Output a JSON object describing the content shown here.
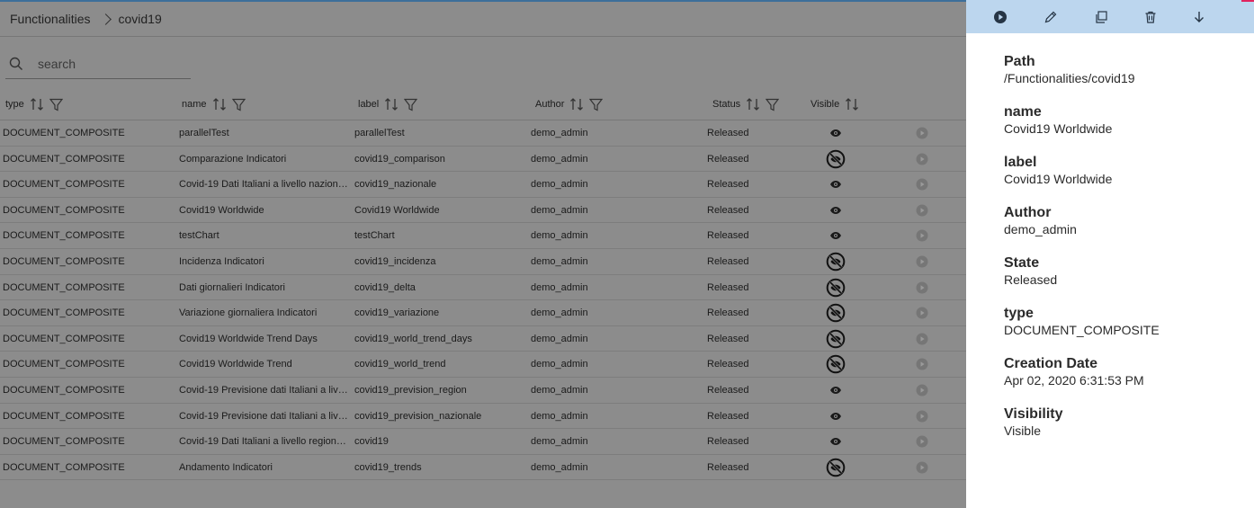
{
  "breadcrumb": {
    "root": "Functionalities",
    "current": "covid19"
  },
  "search": {
    "placeholder": "search"
  },
  "columns": {
    "type": "type",
    "name": "name",
    "label": "label",
    "author": "Author",
    "status": "Status",
    "visible": "Visible"
  },
  "rows": [
    {
      "type": "DOCUMENT_COMPOSITE",
      "name": "parallelTest",
      "label": "parallelTest",
      "author": "demo_admin",
      "status": "Released",
      "visible": true
    },
    {
      "type": "DOCUMENT_COMPOSITE",
      "name": "Comparazione Indicatori",
      "label": "covid19_comparison",
      "author": "demo_admin",
      "status": "Released",
      "visible": false
    },
    {
      "type": "DOCUMENT_COMPOSITE",
      "name": "Covid-19 Dati Italiani a livello nazion…",
      "label": "covid19_nazionale",
      "author": "demo_admin",
      "status": "Released",
      "visible": true
    },
    {
      "type": "DOCUMENT_COMPOSITE",
      "name": "Covid19 Worldwide",
      "label": "Covid19 Worldwide",
      "author": "demo_admin",
      "status": "Released",
      "visible": true
    },
    {
      "type": "DOCUMENT_COMPOSITE",
      "name": "testChart",
      "label": "testChart",
      "author": "demo_admin",
      "status": "Released",
      "visible": true
    },
    {
      "type": "DOCUMENT_COMPOSITE",
      "name": "Incidenza Indicatori",
      "label": "covid19_incidenza",
      "author": "demo_admin",
      "status": "Released",
      "visible": false
    },
    {
      "type": "DOCUMENT_COMPOSITE",
      "name": "Dati giornalieri Indicatori",
      "label": "covid19_delta",
      "author": "demo_admin",
      "status": "Released",
      "visible": false
    },
    {
      "type": "DOCUMENT_COMPOSITE",
      "name": "Variazione giornaliera Indicatori",
      "label": "covid19_variazione",
      "author": "demo_admin",
      "status": "Released",
      "visible": false
    },
    {
      "type": "DOCUMENT_COMPOSITE",
      "name": "Covid19 Worldwide Trend Days",
      "label": "covid19_world_trend_days",
      "author": "demo_admin",
      "status": "Released",
      "visible": false
    },
    {
      "type": "DOCUMENT_COMPOSITE",
      "name": "Covid19 Worldwide Trend",
      "label": "covid19_world_trend",
      "author": "demo_admin",
      "status": "Released",
      "visible": false
    },
    {
      "type": "DOCUMENT_COMPOSITE",
      "name": "Covid-19 Previsione dati Italiani a liv…",
      "label": "covid19_prevision_region",
      "author": "demo_admin",
      "status": "Released",
      "visible": true
    },
    {
      "type": "DOCUMENT_COMPOSITE",
      "name": "Covid-19 Previsione dati Italiani a liv…",
      "label": "covid19_prevision_nazionale",
      "author": "demo_admin",
      "status": "Released",
      "visible": true
    },
    {
      "type": "DOCUMENT_COMPOSITE",
      "name": "Covid-19 Dati Italiani a livello regiona…",
      "label": "covid19",
      "author": "demo_admin",
      "status": "Released",
      "visible": true
    },
    {
      "type": "DOCUMENT_COMPOSITE",
      "name": "Andamento Indicatori",
      "label": "covid19_trends",
      "author": "demo_admin",
      "status": "Released",
      "visible": false
    }
  ],
  "details": {
    "path_label": "Path",
    "path_value": "/Functionalities/covid19",
    "name_label": "name",
    "name_value": "Covid19 Worldwide",
    "label_label": "label",
    "label_value": "Covid19 Worldwide",
    "author_label": "Author",
    "author_value": "demo_admin",
    "state_label": "State",
    "state_value": "Released",
    "type_label": "type",
    "type_value": "DOCUMENT_COMPOSITE",
    "date_label": "Creation Date",
    "date_value": "Apr 02, 2020 6:31:53 PM",
    "visibility_label": "Visibility",
    "visibility_value": "Visible"
  },
  "toolbar_icons": [
    "play-icon",
    "pencil-icon",
    "copy-icon",
    "trash-icon",
    "arrow-down-icon"
  ],
  "colors": {
    "toolbar_bg": "#bcd6ee",
    "overlay": "#8c8c8c",
    "accent_line": "#3d6f9a"
  }
}
